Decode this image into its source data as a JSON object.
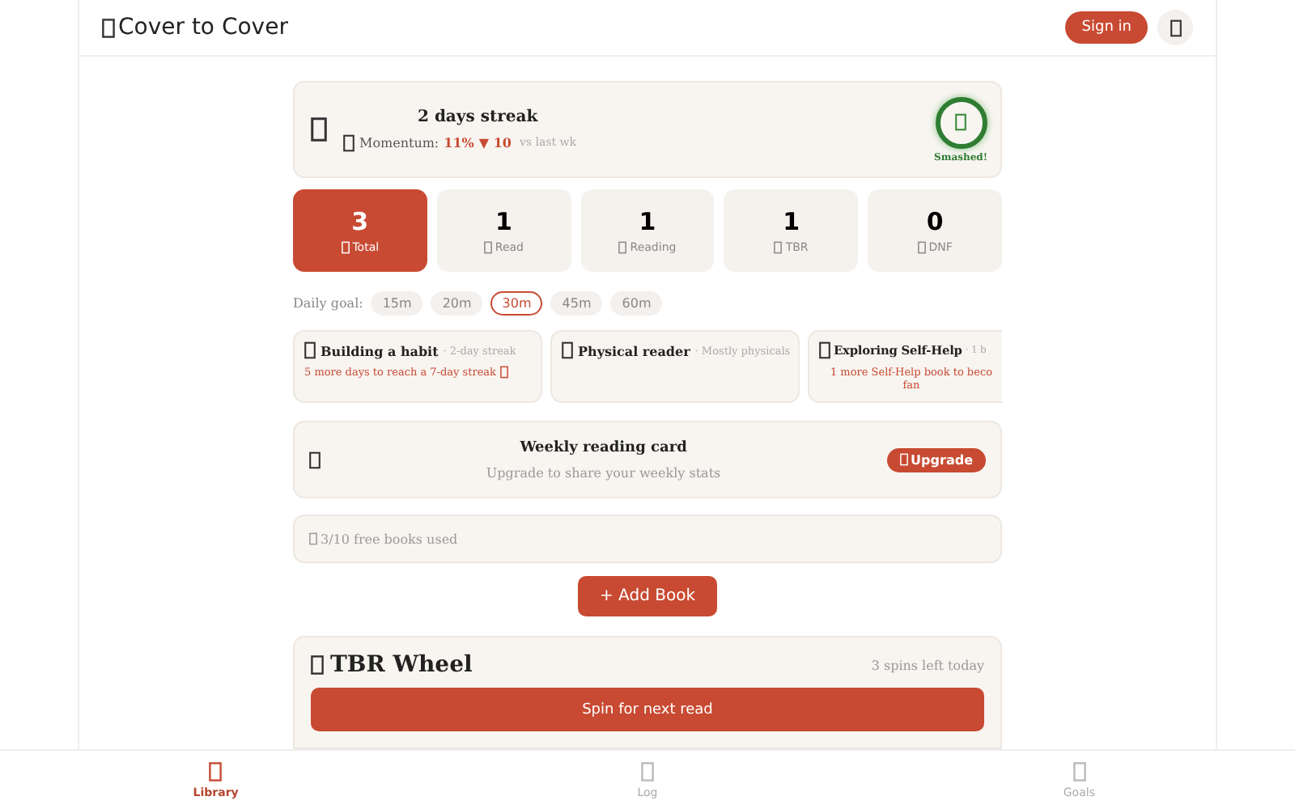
{
  "header": {
    "title": "Cover to Cover",
    "sign_in": "Sign in"
  },
  "streak": {
    "title": "2 days streak",
    "momentum_label": "Momentum:",
    "momentum_value": "11%",
    "momentum_change": "▼ 10",
    "momentum_suffix": "vs last wk",
    "badge": "Smashed!"
  },
  "stats": [
    {
      "value": "3",
      "label": "Total",
      "selected": true
    },
    {
      "value": "1",
      "label": "Read",
      "selected": false
    },
    {
      "value": "1",
      "label": "Reading",
      "selected": false
    },
    {
      "value": "1",
      "label": "TBR",
      "selected": false
    },
    {
      "value": "0",
      "label": "DNF",
      "selected": false
    }
  ],
  "daily_goal": {
    "label": "Daily goal:",
    "options": [
      {
        "label": "15m",
        "selected": false
      },
      {
        "label": "20m",
        "selected": false
      },
      {
        "label": "30m",
        "selected": true
      },
      {
        "label": "45m",
        "selected": false
      },
      {
        "label": "60m",
        "selected": false
      }
    ]
  },
  "insights": [
    {
      "title": "Building a habit",
      "detail": "· 2-day streak",
      "hint": "5 more days to reach a 7-day streak"
    },
    {
      "title": "Physical reader",
      "detail": "· Mostly physicals"
    },
    {
      "title": "Exploring Self-Help",
      "detail": "· 1 b",
      "hint": "1 more Self-Help book to beco\nfan"
    }
  ],
  "weekly_card": {
    "title": "Weekly reading card",
    "subtitle": "Upgrade to share your weekly stats",
    "button": "Upgrade"
  },
  "free_books": "3/10 free books used",
  "add_book": "+ Add Book",
  "tbr_wheel": {
    "title": "TBR Wheel",
    "spins": "3 spins left today",
    "button": "Spin for next read"
  },
  "nav": [
    {
      "label": "Library",
      "selected": true
    },
    {
      "label": "Log",
      "selected": false
    },
    {
      "label": "Goals",
      "selected": false
    }
  ]
}
